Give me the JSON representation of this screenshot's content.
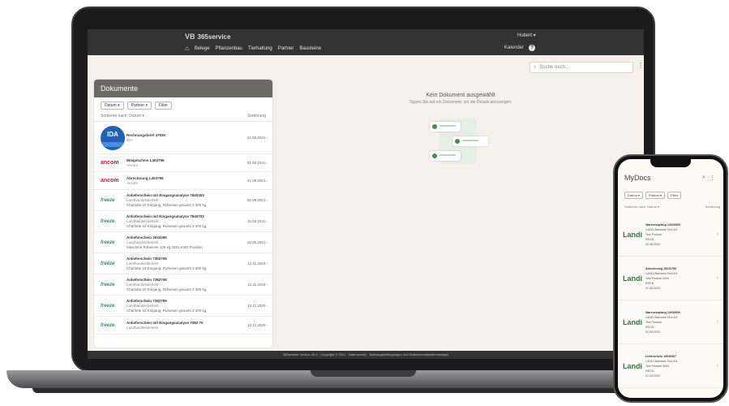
{
  "laptop": {
    "brand": "365service",
    "brand_logo": "VB",
    "nav": [
      "Belege",
      "Pflanzenbau",
      "Tierhaltung",
      "Partner",
      "Bausteine"
    ],
    "user_menu": "Hubert ▾",
    "calendar_label": "Kalender",
    "search_placeholder": "Suche nach...",
    "panel_title": "Dokumente",
    "filters": [
      "Datum ▾",
      "Partner ▾",
      "Filter"
    ],
    "sort_label": "Sortieren nach: Datum ▾",
    "sort_right": "Sortierung",
    "documents": [
      {
        "logo": "IDA",
        "logo_type": "ida",
        "title": "Rechnungsbrief 47930",
        "sub": "IDA",
        "extra": "",
        "date": "31.08.2021 ‹",
        "size": "big"
      },
      {
        "logo": "ancom",
        "logo_type": "ancom",
        "title": "Wiegeschein L403795",
        "sub": "Ancom",
        "extra": "",
        "date": "31.08.2021 ‹",
        "size": "normal"
      },
      {
        "logo": "ancom",
        "logo_type": "ancom",
        "title": "Abrechnung L403795",
        "sub": "Ancom",
        "extra": "",
        "date": "31.08.2021 ‹",
        "size": "normal"
      },
      {
        "logo": "freeze",
        "logo_type": "freeze",
        "title": "Anlieferschein mit Eingangsanalyse 7840303",
        "sub": "Landhandelsbetrieb",
        "extra": "Charlotte 15 Eingang: Roheisen gesamt 2 300 kg",
        "date": "28.08.2021 ‹",
        "size": "tall"
      },
      {
        "logo": "freeze",
        "logo_type": "freeze",
        "title": "Anlieferschein mit Eingangsanalyse 7840702",
        "sub": "Landhandelsbetrieb",
        "extra": "Charlotte 15 Eingang: Roheisen gesamt 2 300 kg",
        "date": "18.08.2021 ‹",
        "size": "tall"
      },
      {
        "logo": "freeze",
        "logo_type": "freeze",
        "title": "Anlieferschein 3034295",
        "sub": "Landhandelsbetrieb",
        "extra": "Maschine Roheisen 100 kg 2021 KW3 Position",
        "date": "18.08.2021 ‹",
        "size": "tall"
      },
      {
        "logo": "freeze",
        "logo_type": "freeze",
        "title": "Anlieferschein 7382706",
        "sub": "Landhandelsbetrieb",
        "extra": "Charlotte 15 Eingang: Roheisen gesamt 2 300 kg",
        "date": "12.11.2020 ‹",
        "size": "tall"
      },
      {
        "logo": "freeze",
        "logo_type": "freeze",
        "title": "Anlieferschein 7382708",
        "sub": "Landhandelsbetrieb",
        "extra": "Charlotte 15 Eingang: Roheisen gesamt 2 300 kg",
        "date": "12.11.2020 ‹",
        "size": "tall"
      },
      {
        "logo": "freeze",
        "logo_type": "freeze",
        "title": "Anlieferschein 7382709",
        "sub": "Landhandelsbetrieb",
        "extra": "Charlotte 15 Eingang: Roheisen gesamt 2 300 kg",
        "date": "12.11.2020 ‹",
        "size": "tall"
      },
      {
        "logo": "freeze",
        "logo_type": "freeze",
        "title": "Anlieferschein mit Eingangsanalyse 7382 70",
        "sub": "Landhandelsbetrieb",
        "extra": "",
        "date": "12.11.2020 ‹",
        "size": "normal"
      }
    ],
    "empty_title": "Kein Dokument ausgewählt",
    "empty_sub": "Tippen Sie auf ein Dokument, um die Details anzuzeigen.",
    "footer": "365service Version 20.4 · Copyright © 2021 · Datenschutz · Nutzungsbedingungen und Datenschutzbestimmungen"
  },
  "phone": {
    "title": "MyDocs",
    "filters": [
      "Datum ▾",
      "Partner ▾",
      "Filter"
    ],
    "sort_label": "Sortieren nach: Datum ▾",
    "sort_right": "Sortierung",
    "items": [
      {
        "logo": "Landi",
        "title": "Warenempfang 10030505",
        "lines": [
          "LANDI Bahnsee Tent AG",
          "Test Produkt",
          "RECN",
          "02.08.2020"
        ]
      },
      {
        "logo": "Landi",
        "title": "Abrechnung 15010796",
        "lines": [
          "LANDI Bahnsee Tent AG",
          "Test Produkt 2000",
          "RECN",
          "01.06.2020"
        ]
      },
      {
        "logo": "Landi",
        "title": "Warenempfang 10030500",
        "lines": [
          "LANDI Bahnsee Tent AG",
          "Test Produkt",
          "RECN",
          "01.09.2020"
        ]
      },
      {
        "logo": "Landi",
        "title": "Lieferschein 10030507",
        "lines": [
          "LANDI Bahnsee Tent AG",
          "Test Produkt 9000",
          "RECN",
          "01.06.2020"
        ]
      }
    ]
  }
}
